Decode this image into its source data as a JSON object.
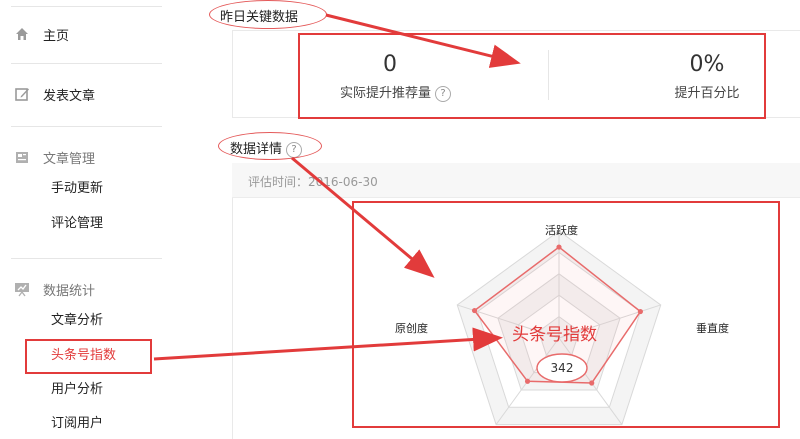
{
  "sidebar": {
    "home": "主页",
    "publish": "发表文章",
    "article_mgmt": {
      "title": "文章管理",
      "items": [
        "手动更新",
        "评论管理"
      ]
    },
    "data_stats": {
      "title": "数据统计",
      "items": [
        "文章分析",
        "头条号指数",
        "用户分析",
        "订阅用户"
      ]
    }
  },
  "yesterday": {
    "title": "昨日关键数据",
    "stats": [
      {
        "value": "0",
        "label": "实际提升推荐量"
      },
      {
        "value": "0%",
        "label": "提升百分比"
      }
    ]
  },
  "details": {
    "title": "数据详情",
    "eval_time": "评估时间：2016-06-30",
    "axes": {
      "top": "活跃度",
      "left": "原创度",
      "right": "垂直度"
    },
    "index_title": "头条号指数",
    "index_value": "342"
  },
  "chart_data": {
    "type": "radar",
    "title": "",
    "axes": [
      "活跃度",
      "垂直度",
      "",
      "",
      "原创度"
    ],
    "series": [
      {
        "values": [
          0.85,
          0.8,
          0.52,
          0.5,
          0.83
        ]
      }
    ],
    "rings": 5,
    "max": 1
  },
  "colors": {
    "annotation_red": "#e23b3b",
    "radar_line": "#e86b6b",
    "grid": "#d9d9d9"
  }
}
